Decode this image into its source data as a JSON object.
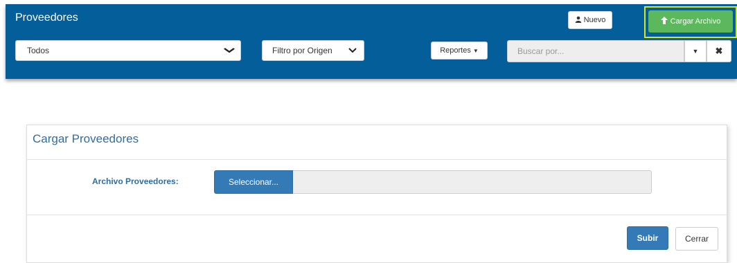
{
  "header": {
    "title": "Proveedores",
    "nuevo_label": "Nuevo",
    "nuevo_icon": "user-icon",
    "cargar_label": "Cargar Archivo",
    "cargar_icon": "arrow-up-icon",
    "highlight_color": "#d7e81e"
  },
  "filters": {
    "todos_value": "Todos",
    "origen_value": "Filtro por Origen",
    "reportes_label": "Reportes",
    "search_placeholder": "Buscar por..."
  },
  "panel": {
    "title": "Cargar Proveedores",
    "field_label": "Archivo Proveedores:",
    "select_button": "Seleccionar...",
    "subir_button": "Subir",
    "cerrar_button": "Cerrar"
  },
  "colors": {
    "header_bg": "#045e99",
    "primary": "#337ab7",
    "success": "#5cb85c"
  }
}
